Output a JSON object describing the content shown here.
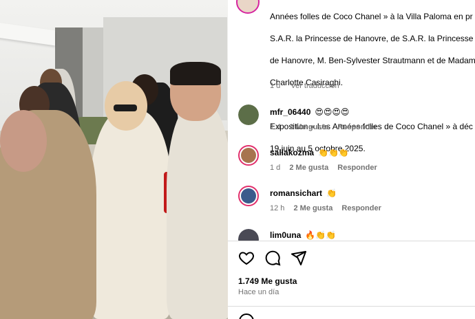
{
  "caption": {
    "lines": [
      "Années folles de Coco Chanel » à la Villa Paloma en pr",
      "S.A.R. la Princesse de Hanovre, de S.A.R. la Princesse A",
      "de Hanovre, M. Ben-Sylvester Strautmann et de Madam",
      "Charlotte Casiraghi.",
      "",
      "Exposition « Les Années folles de Coco Chanel » à déc",
      "19 juin au 5 octobre 2025."
    ],
    "time": "1 d",
    "translate": "Ver traducción"
  },
  "comments": [
    {
      "user": "mfr_06440",
      "text": "😍😍😍😍",
      "time": "1 d",
      "likes": "2 Me gusta",
      "reply": "Responder",
      "avatar_color": "#5c6e48"
    },
    {
      "user": "sallakozma",
      "text": "👏👏👏",
      "time": "1 d",
      "likes": "2 Me gusta",
      "reply": "Responder",
      "avatar_color": "#a7744e"
    },
    {
      "user": "romansichart",
      "text": "👏",
      "time": "12 h",
      "likes": "2 Me gusta",
      "reply": "Responder",
      "avatar_color": "#3b5b8c"
    },
    {
      "user": "lim0una",
      "text": "🔥👏👏",
      "time": "",
      "likes": "",
      "reply": "",
      "avatar_color": "#4a4a55"
    }
  ],
  "actions": {
    "like_icon": "heart-icon",
    "comment_icon": "comment-icon",
    "share_icon": "send-icon"
  },
  "likes_text": "1.749 Me gusta",
  "posted_when": "Hace un día"
}
